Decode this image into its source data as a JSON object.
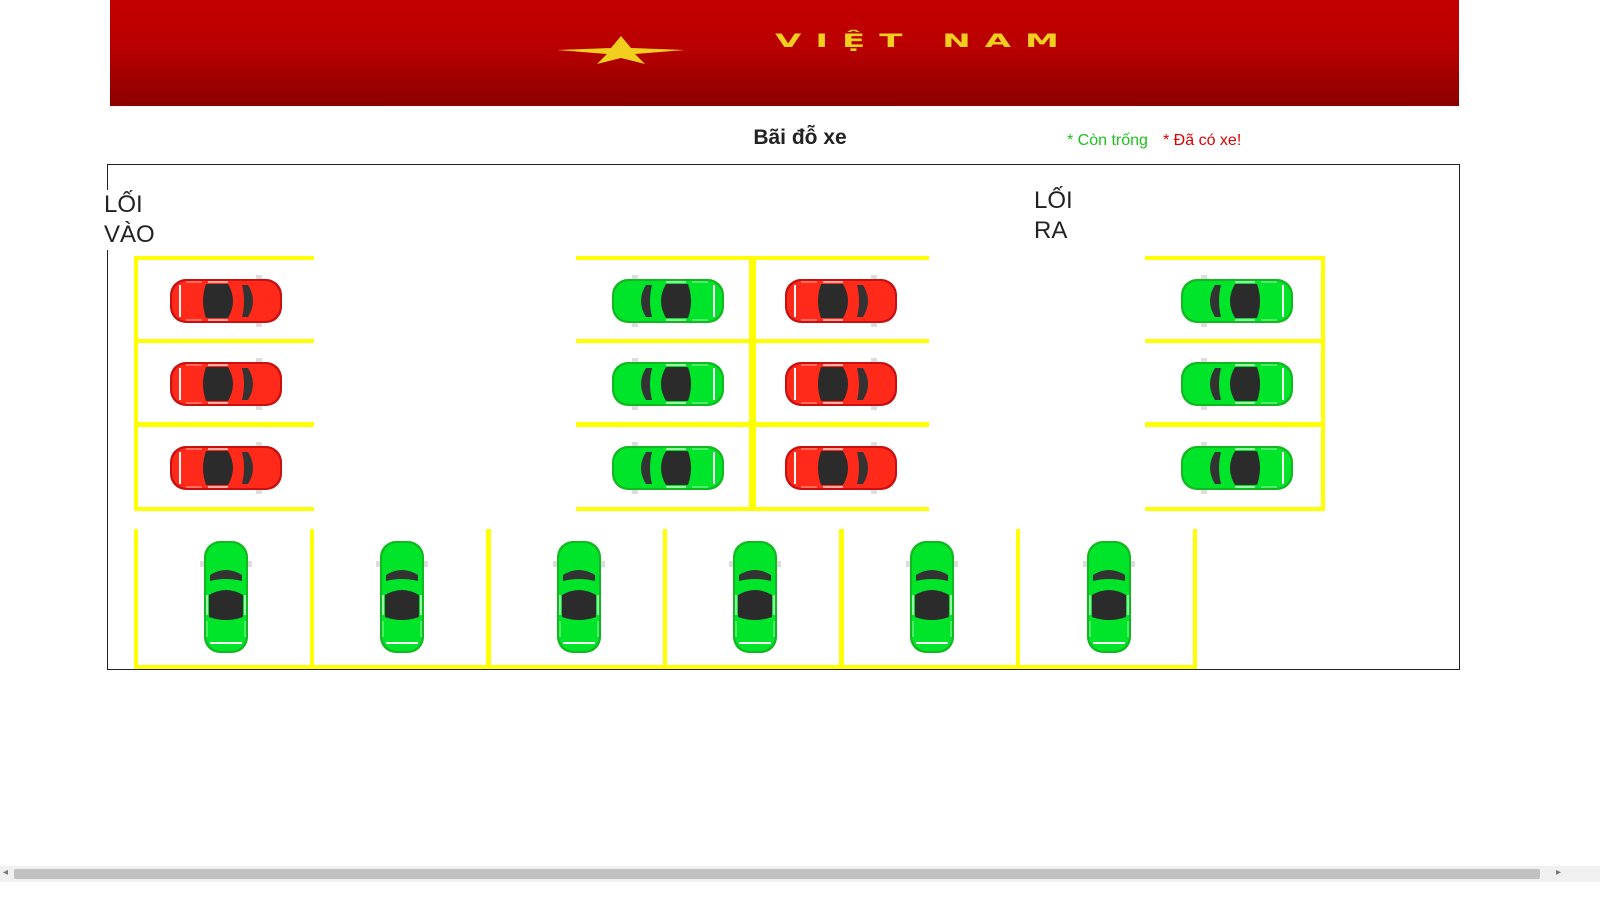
{
  "banner": {
    "text": "VIỆT NAM",
    "star": "star-icon"
  },
  "title": "Bãi đỗ xe",
  "legend": {
    "free": "* Còn trống",
    "taken": "* Đã có xe!",
    "free_color": "#00e52a",
    "taken_color": "#ff1a1a"
  },
  "gates": {
    "entry_line1": "LỐI",
    "entry_line2": "VÀO",
    "exit_line1": "LỐI",
    "exit_line2": "RA"
  },
  "spots": [
    {
      "id": "A1",
      "status": "taken"
    },
    {
      "id": "A2",
      "status": "taken"
    },
    {
      "id": "A3",
      "status": "taken"
    },
    {
      "id": "B1",
      "status": "free"
    },
    {
      "id": "B2",
      "status": "free"
    },
    {
      "id": "B3",
      "status": "free"
    },
    {
      "id": "C1",
      "status": "taken"
    },
    {
      "id": "C2",
      "status": "taken"
    },
    {
      "id": "C3",
      "status": "taken"
    },
    {
      "id": "D1",
      "status": "free"
    },
    {
      "id": "D2",
      "status": "free"
    },
    {
      "id": "D3",
      "status": "free"
    },
    {
      "id": "E1",
      "status": "free"
    },
    {
      "id": "E2",
      "status": "free"
    },
    {
      "id": "E3",
      "status": "free"
    },
    {
      "id": "E4",
      "status": "free"
    },
    {
      "id": "E5",
      "status": "free"
    },
    {
      "id": "E6",
      "status": "free"
    }
  ],
  "scrollbar": {
    "left_arrow": "◂",
    "right_arrow": "▸"
  }
}
